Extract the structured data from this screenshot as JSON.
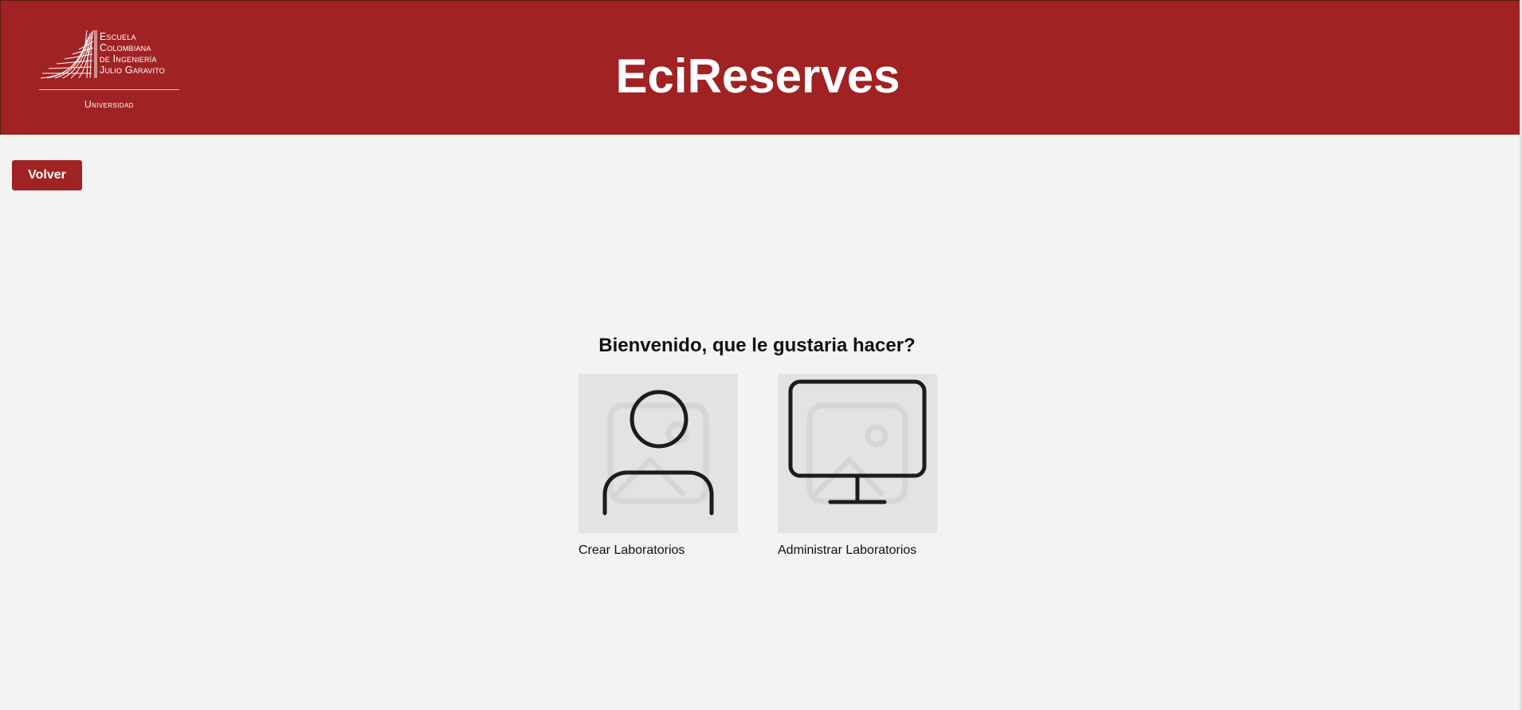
{
  "header": {
    "logo": {
      "line1": "Escuela",
      "line2": "Colombiana",
      "line3": "de Ingeniería",
      "line4": "Julio Garavito",
      "subtitle": "Universidad"
    },
    "title": "EciReserves",
    "color": "#a02223"
  },
  "toolbar": {
    "back_label": "Volver"
  },
  "main": {
    "welcome": "Bienvenido, que le gustaria hacer?",
    "options": [
      {
        "label": "Crear Laboratorios",
        "icon": "user-icon"
      },
      {
        "label": "Administrar Laboratorios",
        "icon": "monitor-icon"
      }
    ]
  }
}
